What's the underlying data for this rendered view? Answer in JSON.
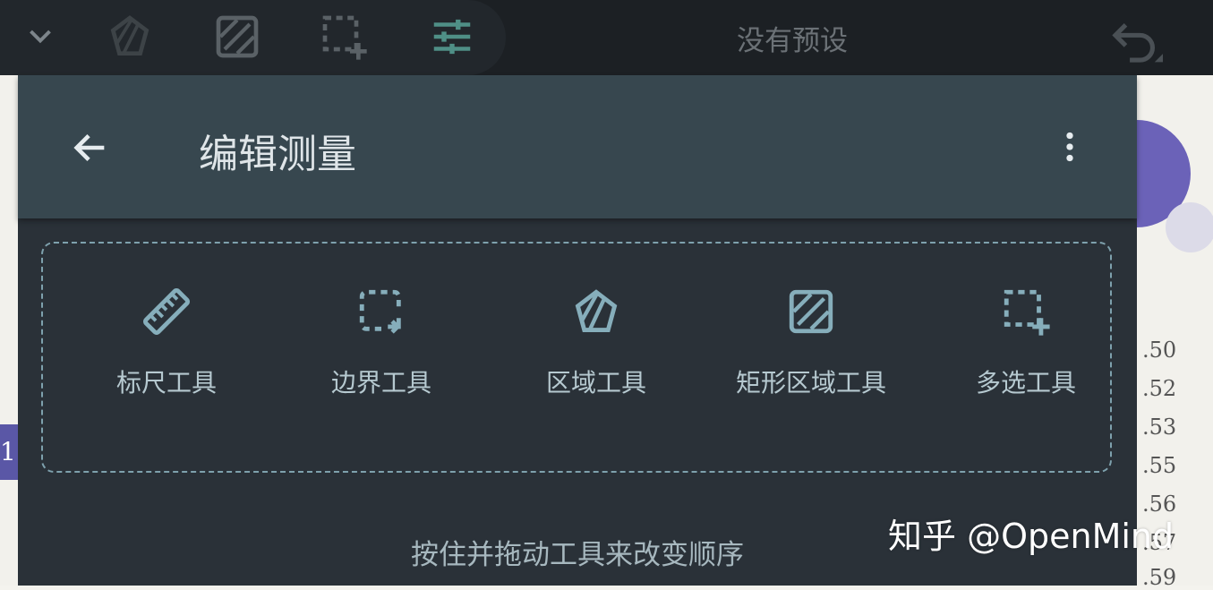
{
  "topbar": {
    "icons": [
      "chevron-down-icon",
      "polygon-area-icon",
      "rect-area-icon",
      "multi-select-icon",
      "sliders-icon"
    ],
    "preset_label": "没有预设",
    "undo_icon": "undo-icon",
    "colors": {
      "background": "#1c2024",
      "active_icon": "#4f8f86",
      "inactive_icon": "#545b61"
    }
  },
  "background_doc": {
    "side_values": [
      ".50",
      ".52",
      ".53",
      ".55",
      ".56",
      ".57",
      ".59"
    ],
    "badge": "1"
  },
  "dialog": {
    "title": "编辑测量",
    "back_icon": "arrow-left-icon",
    "more_icon": "more-vertical-icon",
    "tools": [
      {
        "label": "标尺工具",
        "icon": "ruler-icon"
      },
      {
        "label": "边界工具",
        "icon": "perimeter-icon"
      },
      {
        "label": "区域工具",
        "icon": "polygon-area-icon"
      },
      {
        "label": "矩形区域工具",
        "icon": "rect-area-icon"
      },
      {
        "label": "多选工具",
        "icon": "multi-select-icon"
      }
    ],
    "hint": "按住并拖动工具来改变顺序",
    "colors": {
      "header": "#37474f",
      "body": "#2a3138",
      "icon": "#86aebb"
    }
  },
  "watermark": "知乎 @OpenMind"
}
